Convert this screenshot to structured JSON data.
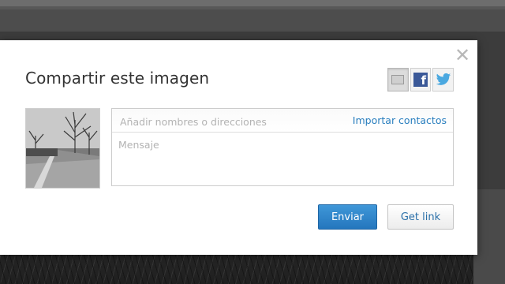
{
  "dialog": {
    "title": "Compartir este imagen",
    "close_symbol": "✕",
    "share_services": [
      {
        "icon": "email-icon",
        "active": true
      },
      {
        "icon": "facebook-icon",
        "glyph": "f"
      },
      {
        "icon": "twitter-icon"
      }
    ],
    "recipients_placeholder": "Añadir nombres o direcciones",
    "import_contacts_label": "Importar contactos",
    "message_placeholder": "Mensaje",
    "send_label": "Enviar",
    "get_link_label": "Get link"
  },
  "colors": {
    "facebook": "#3b5998",
    "twitter": "#4aa8e0",
    "primary_button": "#2a7fc8",
    "link_text": "#2a7fbf"
  }
}
